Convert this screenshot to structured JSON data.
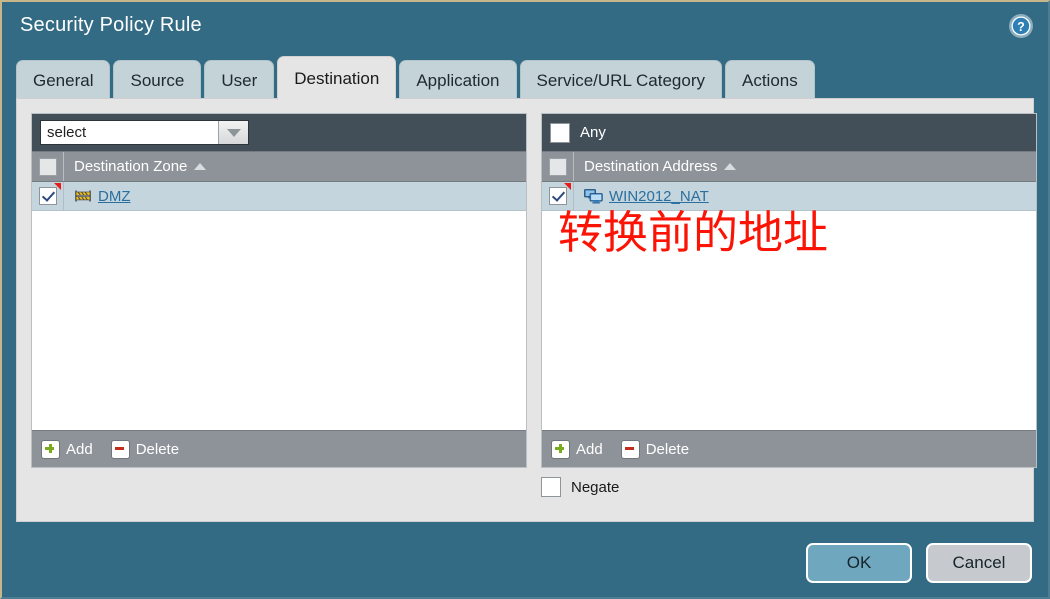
{
  "window": {
    "title": "Security Policy Rule",
    "help_icon": "help-circle-icon"
  },
  "tabs": [
    {
      "label": "General",
      "active": false
    },
    {
      "label": "Source",
      "active": false
    },
    {
      "label": "User",
      "active": false
    },
    {
      "label": "Destination",
      "active": true
    },
    {
      "label": "Application",
      "active": false
    },
    {
      "label": "Service/URL Category",
      "active": false
    },
    {
      "label": "Actions",
      "active": false
    }
  ],
  "left_panel": {
    "select_value": "select",
    "select_placeholder": "select",
    "dropdown_icon": "chevron-down-icon",
    "column_header": "Destination Zone",
    "sort_indicator": "sort-ascending-icon",
    "header_checkbox_checked": false,
    "rows": [
      {
        "label": "DMZ",
        "checked": true,
        "icon": "zone-barrier-icon",
        "flagged": true
      }
    ],
    "add_label": "Add",
    "delete_label": "Delete"
  },
  "right_panel": {
    "any_label": "Any",
    "any_checked": false,
    "column_header": "Destination Address",
    "sort_indicator": "sort-ascending-icon",
    "header_checkbox_checked": false,
    "rows": [
      {
        "label": "WIN2012_NAT",
        "checked": true,
        "icon": "address-computers-icon",
        "flagged": true
      }
    ],
    "annotation": "转换前的地址",
    "add_label": "Add",
    "delete_label": "Delete"
  },
  "negate": {
    "label": "Negate",
    "checked": false
  },
  "buttons": {
    "ok_label": "OK",
    "cancel_label": "Cancel"
  },
  "colors": {
    "dialog_chrome": "#336b84",
    "tab_active_bg": "#e5e5e5",
    "tab_inactive_bg": "#c3d3d8",
    "toolbar_dark": "#434f58",
    "header_gray": "#8e9399",
    "row_selected": "#c5d5de",
    "link_blue": "#2a6f9e",
    "annotation_red": "#fb1405",
    "ok_button": "#6fa7bf",
    "cancel_button": "#c6cace",
    "top_border": "#c6b68a"
  }
}
